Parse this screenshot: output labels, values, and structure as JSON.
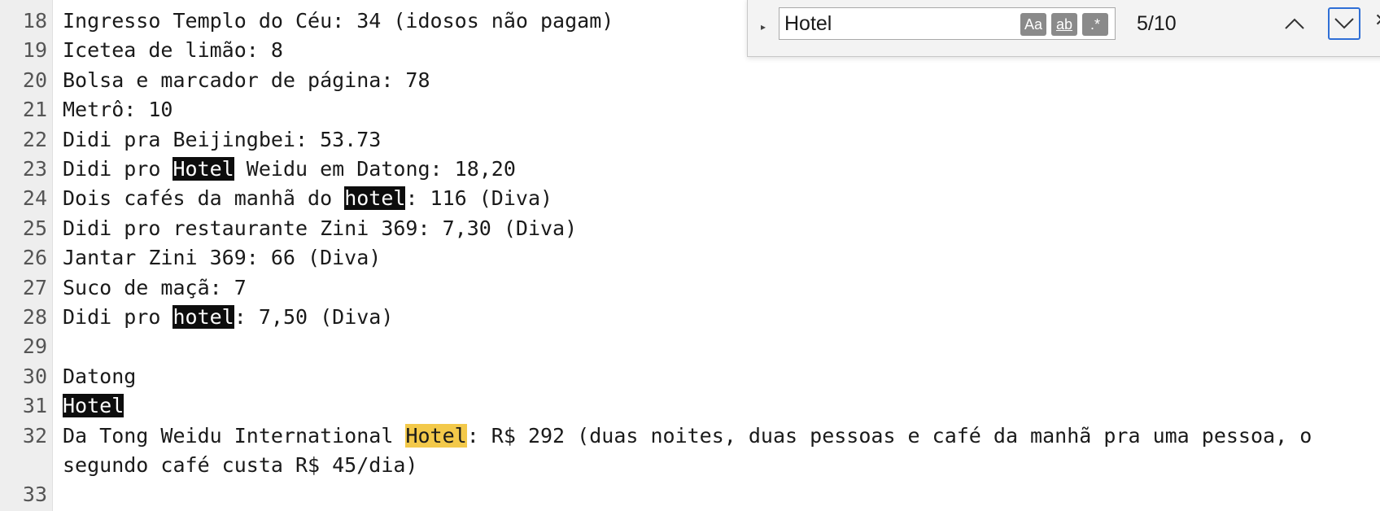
{
  "editor": {
    "lines": [
      {
        "num": "18",
        "segments": [
          {
            "text": "Ingresso Templo do Céu: 34 (idosos não pagam)",
            "hl": ""
          }
        ]
      },
      {
        "num": "19",
        "segments": [
          {
            "text": "Icetea de limão: 8",
            "hl": ""
          }
        ]
      },
      {
        "num": "20",
        "segments": [
          {
            "text": "Bolsa e marcador de página: 78",
            "hl": ""
          }
        ]
      },
      {
        "num": "21",
        "segments": [
          {
            "text": "Metrô: 10",
            "hl": ""
          }
        ]
      },
      {
        "num": "22",
        "segments": [
          {
            "text": "Didi pra Beijingbei: 53.73",
            "hl": ""
          }
        ]
      },
      {
        "num": "23",
        "segments": [
          {
            "text": "Didi pro ",
            "hl": ""
          },
          {
            "text": "Hotel",
            "hl": "match"
          },
          {
            "text": " Weidu em Datong: 18,20",
            "hl": ""
          }
        ]
      },
      {
        "num": "24",
        "segments": [
          {
            "text": "Dois cafés da manhã do ",
            "hl": ""
          },
          {
            "text": "hotel",
            "hl": "match"
          },
          {
            "text": ": 116 (Diva)",
            "hl": ""
          }
        ]
      },
      {
        "num": "25",
        "segments": [
          {
            "text": "Didi pro restaurante Zini 369: 7,30 (Diva)",
            "hl": ""
          }
        ]
      },
      {
        "num": "26",
        "segments": [
          {
            "text": "Jantar Zini 369: 66 (Diva)",
            "hl": ""
          }
        ]
      },
      {
        "num": "27",
        "segments": [
          {
            "text": "Suco de maçã: 7",
            "hl": ""
          }
        ]
      },
      {
        "num": "28",
        "segments": [
          {
            "text": "Didi pro ",
            "hl": ""
          },
          {
            "text": "hotel",
            "hl": "match"
          },
          {
            "text": ": 7,50 (Diva)",
            "hl": ""
          }
        ]
      },
      {
        "num": "29",
        "segments": []
      },
      {
        "num": "30",
        "segments": [
          {
            "text": "Datong",
            "hl": ""
          }
        ]
      },
      {
        "num": "31",
        "segments": [
          {
            "text": "Hotel",
            "hl": "match"
          }
        ]
      },
      {
        "num": "32",
        "segments": [
          {
            "text": "Da Tong Weidu International ",
            "hl": ""
          },
          {
            "text": "Hotel",
            "hl": "current"
          },
          {
            "text": ": R$ 292 (duas noites, duas pessoas e café da manhã pra uma pessoa, o",
            "hl": ""
          }
        ]
      },
      {
        "num": "",
        "segments": [
          {
            "text": "segundo café custa R$ 45/dia)",
            "hl": ""
          }
        ]
      },
      {
        "num": "33",
        "segments": []
      }
    ]
  },
  "find": {
    "query": "Hotel",
    "match_case_label": "Aa",
    "whole_word_label": "ab",
    "regex_label": ".*",
    "count": "5/10",
    "toggle_icon": "triangle-right-icon",
    "prev_icon": "chevron-up-icon",
    "next_icon": "chevron-down-icon",
    "close_icon": "close-icon",
    "match_color": "#0d0d0d",
    "current_match_color": "#f3c94a",
    "focus_color": "#2f6fd6"
  }
}
